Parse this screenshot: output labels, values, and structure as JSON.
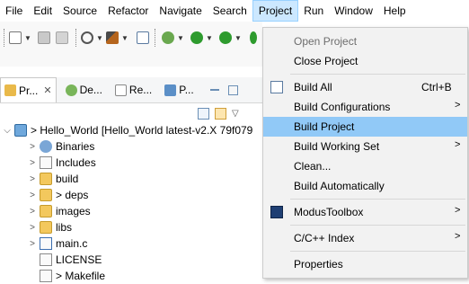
{
  "menubar": [
    "File",
    "Edit",
    "Source",
    "Refactor",
    "Navigate",
    "Search",
    "Project",
    "Run",
    "Window",
    "Help"
  ],
  "tabs": [
    {
      "label": "Pr...",
      "close": "✕",
      "icon": "project-explorer-icon"
    },
    {
      "label": "De...",
      "icon": "debug-icon"
    },
    {
      "label": "Re...",
      "icon": "registers-icon"
    },
    {
      "label": "P...",
      "icon": "peripherals-icon"
    }
  ],
  "tree": [
    {
      "label": "> Hello_World [Hello_World latest-v2.X 79f079",
      "icon": "project-icon",
      "twisty": "⌵"
    },
    {
      "label": "Binaries",
      "icon": "binaries-icon",
      "twisty": ">"
    },
    {
      "label": "Includes",
      "icon": "includes-icon",
      "twisty": ">"
    },
    {
      "label": "build",
      "icon": "folder-icon",
      "twisty": ">"
    },
    {
      "label": "> deps",
      "icon": "folder-icon",
      "twisty": ">"
    },
    {
      "label": "images",
      "icon": "folder-icon",
      "twisty": ">"
    },
    {
      "label": "libs",
      "icon": "folder-icon",
      "twisty": ">"
    },
    {
      "label": "main.c",
      "icon": "c-file-icon",
      "twisty": ">"
    },
    {
      "label": "LICENSE",
      "icon": "file-icon",
      "twisty": ""
    },
    {
      "label": "> Makefile",
      "icon": "file-icon",
      "twisty": ""
    }
  ],
  "project_menu": [
    {
      "label": "Open Project",
      "disabled": true
    },
    {
      "label": "Close Project"
    },
    {
      "separator": true
    },
    {
      "label": "Build All",
      "shortcut": "Ctrl+B",
      "icon": "build-all-icon"
    },
    {
      "label": "Build Configurations",
      "submenu": ">"
    },
    {
      "label": "Build Project",
      "highlighted": true
    },
    {
      "label": "Build Working Set",
      "submenu": ">"
    },
    {
      "label": "Clean..."
    },
    {
      "label": "Build Automatically"
    },
    {
      "separator": true
    },
    {
      "label": "ModusToolbox",
      "submenu": ">",
      "icon": "modustoolbox-icon"
    },
    {
      "separator": true
    },
    {
      "label": "C/C++ Index",
      "submenu": ">"
    },
    {
      "separator": true
    },
    {
      "label": "Properties"
    }
  ],
  "colors": {
    "menu_highlight": "#91c9f7",
    "menubar_active": "#cce8ff"
  }
}
